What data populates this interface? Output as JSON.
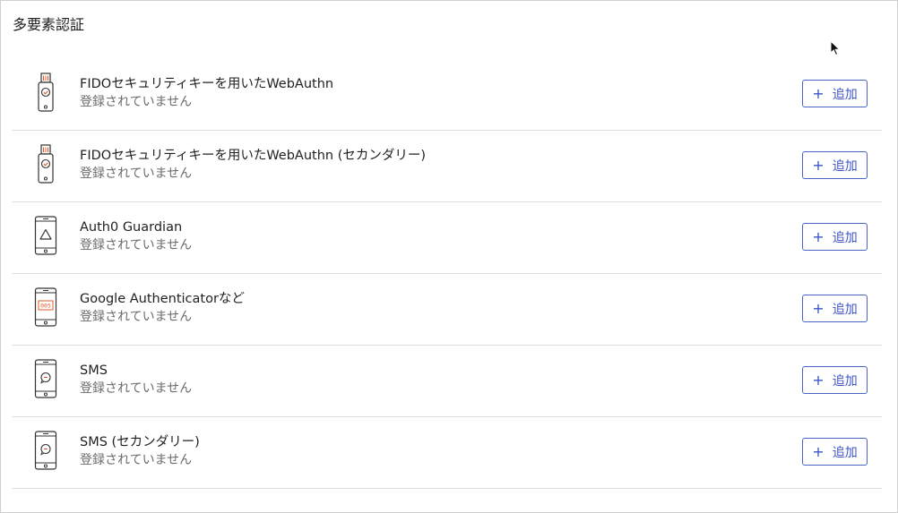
{
  "section": {
    "title": "多要素認証"
  },
  "colors": {
    "accent": "#3c54c4",
    "icon_detail": "#e4572e",
    "border": "#dcdcdc",
    "muted_text": "#6b6b6b"
  },
  "methods": [
    {
      "name": "FIDOセキュリティキーを用いたWebAuthn",
      "status": "登録されていません",
      "icon": "security-key-icon",
      "button_label": "追加",
      "button_icon": "+"
    },
    {
      "name": "FIDOセキュリティキーを用いたWebAuthn (セカンダリー)",
      "status": "登録されていません",
      "icon": "security-key-icon",
      "button_label": "追加",
      "button_icon": "+"
    },
    {
      "name": "Auth0 Guardian",
      "status": "登録されていません",
      "icon": "guardian-phone-icon",
      "button_label": "追加",
      "button_icon": "+"
    },
    {
      "name": "Google Authenticatorなど",
      "status": "登録されていません",
      "icon": "authenticator-phone-icon",
      "button_label": "追加",
      "button_icon": "+",
      "icon_code": "005"
    },
    {
      "name": "SMS",
      "status": "登録されていません",
      "icon": "sms-phone-icon",
      "button_label": "追加",
      "button_icon": "+"
    },
    {
      "name": "SMS (セカンダリー)",
      "status": "登録されていません",
      "icon": "sms-phone-icon",
      "button_label": "追加",
      "button_icon": "+"
    }
  ]
}
